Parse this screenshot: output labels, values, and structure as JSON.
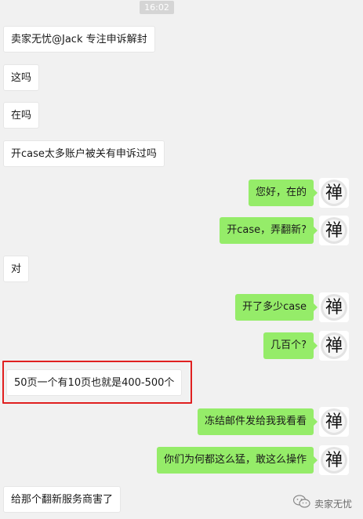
{
  "header": {
    "time": "16:02"
  },
  "messages": [
    {
      "side": "in",
      "text": "卖家无忧@Jack 专注申诉解封"
    },
    {
      "side": "in",
      "text": "这吗"
    },
    {
      "side": "in",
      "text": "在吗"
    },
    {
      "side": "in",
      "text": "开case太多账户被关有申诉过吗"
    },
    {
      "side": "out",
      "text": "您好，在的"
    },
    {
      "side": "out",
      "text": "开case，弄翻新?"
    },
    {
      "side": "in",
      "text": "对"
    },
    {
      "side": "out",
      "text": "开了多少case"
    },
    {
      "side": "out",
      "text": "几百个?"
    },
    {
      "side": "in",
      "text": "50页一个有10页也就是400-500个",
      "highlighted": true
    },
    {
      "side": "out",
      "text": "冻结邮件发给我我看看"
    },
    {
      "side": "out",
      "text": "你们为何都这么猛，敢这么操作"
    },
    {
      "side": "in",
      "text": "给那个翻新服务商害了"
    }
  ],
  "avatar": {
    "glyph": "禅",
    "icon": "zen-calligraphy-avatar-icon"
  },
  "watermark": {
    "text": "卖家无忧",
    "icon": "wechat-logo-icon"
  },
  "colors": {
    "outgoing_bubble": "#95ec69",
    "incoming_bubble": "#ffffff",
    "background": "#f1f1f1",
    "highlight_border": "#e02020"
  }
}
